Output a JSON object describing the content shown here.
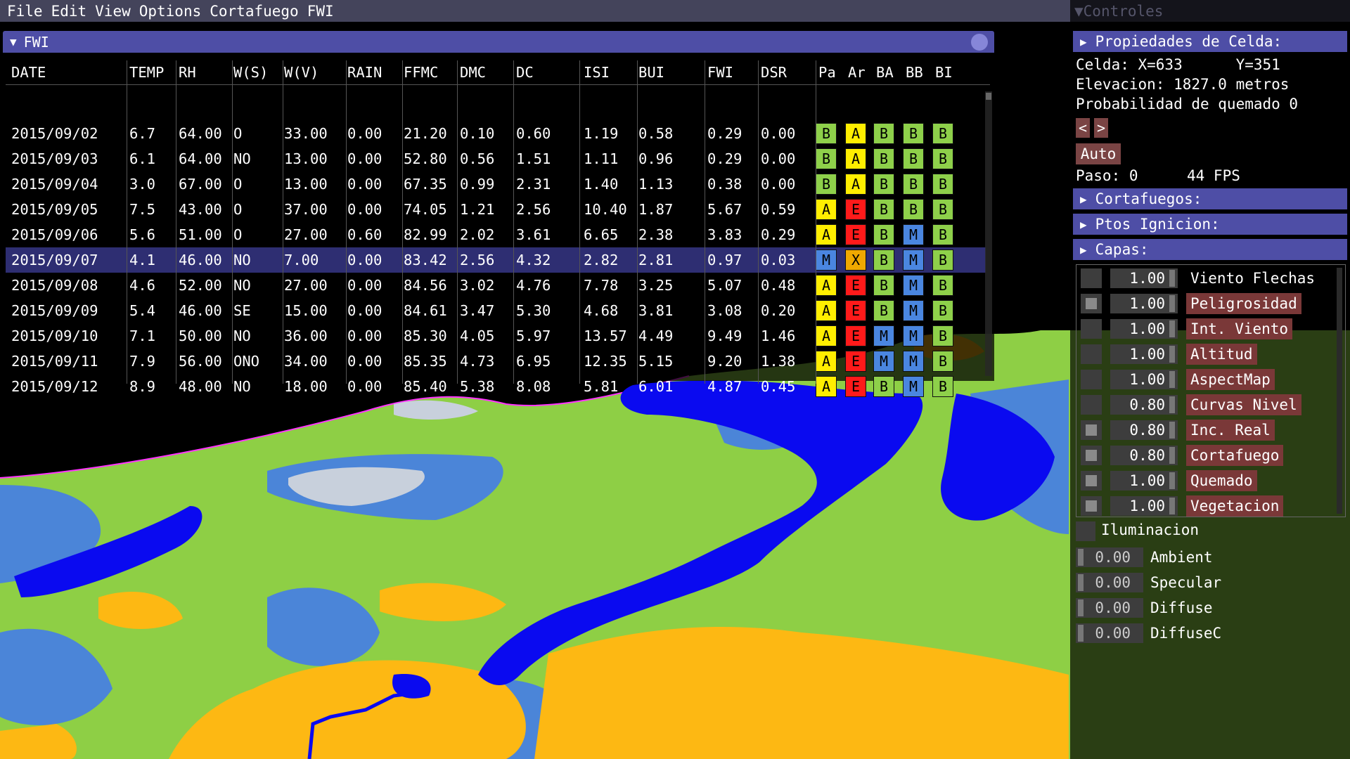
{
  "menu": [
    "File",
    "Edit",
    "View",
    "Options",
    "Cortafuego",
    "FWI"
  ],
  "fwi_window": {
    "title": "FWI",
    "columns": [
      "DATE",
      "TEMP",
      "RH",
      "W(S)",
      "W(V)",
      "RAIN",
      "FFMC",
      "DMC",
      "DC",
      "ISI",
      "BUI",
      "FWI",
      "DSR",
      "Pa",
      "Ar",
      "BA",
      "BB",
      "BI"
    ],
    "selected_row": 5,
    "rows": [
      {
        "date": "2015/09/02",
        "temp": "6.7",
        "rh": "64.00",
        "ws": "O",
        "wv": "33.00",
        "rain": "0.00",
        "ffmc": "21.20",
        "dmc": "0.10",
        "dc": "0.60",
        "isi": "1.19",
        "bui": "0.58",
        "fwi": "0.29",
        "dsr": "0.00",
        "pa": "B",
        "ar": "A",
        "ba": "B",
        "bb": "B",
        "bi": "B"
      },
      {
        "date": "2015/09/03",
        "temp": "6.1",
        "rh": "64.00",
        "ws": "NO",
        "wv": "13.00",
        "rain": "0.00",
        "ffmc": "52.80",
        "dmc": "0.56",
        "dc": "1.51",
        "isi": "1.11",
        "bui": "0.96",
        "fwi": "0.29",
        "dsr": "0.00",
        "pa": "B",
        "ar": "A",
        "ba": "B",
        "bb": "B",
        "bi": "B"
      },
      {
        "date": "2015/09/04",
        "temp": "3.0",
        "rh": "67.00",
        "ws": "O",
        "wv": "13.00",
        "rain": "0.00",
        "ffmc": "67.35",
        "dmc": "0.99",
        "dc": "2.31",
        "isi": "1.40",
        "bui": "1.13",
        "fwi": "0.38",
        "dsr": "0.00",
        "pa": "B",
        "ar": "A",
        "ba": "B",
        "bb": "B",
        "bi": "B"
      },
      {
        "date": "2015/09/05",
        "temp": "7.5",
        "rh": "43.00",
        "ws": "O",
        "wv": "37.00",
        "rain": "0.00",
        "ffmc": "74.05",
        "dmc": "1.21",
        "dc": "2.56",
        "isi": "10.40",
        "bui": "1.87",
        "fwi": "5.67",
        "dsr": "0.59",
        "pa": "A",
        "ar": "E",
        "ba": "B",
        "bb": "B",
        "bi": "B"
      },
      {
        "date": "2015/09/06",
        "temp": "5.6",
        "rh": "51.00",
        "ws": "O",
        "wv": "27.00",
        "rain": "0.60",
        "ffmc": "82.99",
        "dmc": "2.02",
        "dc": "3.61",
        "isi": "6.65",
        "bui": "2.38",
        "fwi": "3.83",
        "dsr": "0.29",
        "pa": "A",
        "ar": "E",
        "ba": "B",
        "bb": "M",
        "bi": "B"
      },
      {
        "date": "2015/09/07",
        "temp": "4.1",
        "rh": "46.00",
        "ws": "NO",
        "wv": "7.00",
        "rain": "0.00",
        "ffmc": "83.42",
        "dmc": "2.56",
        "dc": "4.32",
        "isi": "2.82",
        "bui": "2.81",
        "fwi": "0.97",
        "dsr": "0.03",
        "pa": "M",
        "ar": "X",
        "ba": "B",
        "bb": "M",
        "bi": "B"
      },
      {
        "date": "2015/09/08",
        "temp": "4.6",
        "rh": "52.00",
        "ws": "NO",
        "wv": "27.00",
        "rain": "0.00",
        "ffmc": "84.56",
        "dmc": "3.02",
        "dc": "4.76",
        "isi": "7.78",
        "bui": "3.25",
        "fwi": "5.07",
        "dsr": "0.48",
        "pa": "A",
        "ar": "E",
        "ba": "B",
        "bb": "M",
        "bi": "B"
      },
      {
        "date": "2015/09/09",
        "temp": "5.4",
        "rh": "46.00",
        "ws": "SE",
        "wv": "15.00",
        "rain": "0.00",
        "ffmc": "84.61",
        "dmc": "3.47",
        "dc": "5.30",
        "isi": "4.68",
        "bui": "3.81",
        "fwi": "3.08",
        "dsr": "0.20",
        "pa": "A",
        "ar": "E",
        "ba": "B",
        "bb": "M",
        "bi": "B"
      },
      {
        "date": "2015/09/10",
        "temp": "7.1",
        "rh": "50.00",
        "ws": "NO",
        "wv": "36.00",
        "rain": "0.00",
        "ffmc": "85.30",
        "dmc": "4.05",
        "dc": "5.97",
        "isi": "13.57",
        "bui": "4.49",
        "fwi": "9.49",
        "dsr": "1.46",
        "pa": "A",
        "ar": "E",
        "ba": "M",
        "bb": "M",
        "bi": "B"
      },
      {
        "date": "2015/09/11",
        "temp": "7.9",
        "rh": "56.00",
        "ws": "ONO",
        "wv": "34.00",
        "rain": "0.00",
        "ffmc": "85.35",
        "dmc": "4.73",
        "dc": "6.95",
        "isi": "12.35",
        "bui": "5.15",
        "fwi": "9.20",
        "dsr": "1.38",
        "pa": "A",
        "ar": "E",
        "ba": "M",
        "bb": "M",
        "bi": "B"
      },
      {
        "date": "2015/09/12",
        "temp": "8.9",
        "rh": "48.00",
        "ws": "NO",
        "wv": "18.00",
        "rain": "0.00",
        "ffmc": "85.40",
        "dmc": "5.38",
        "dc": "8.08",
        "isi": "5.81",
        "bui": "6.01",
        "fwi": "4.87",
        "dsr": "0.45",
        "pa": "A",
        "ar": "E",
        "ba": "B",
        "bb": "M",
        "bi": "B"
      }
    ],
    "badge_colors": {
      "B": "#8ed04a",
      "A": "#ffee00",
      "E": "#ff1a1a",
      "M": "#4a86e0",
      "X": "#f0a800"
    }
  },
  "controls": {
    "title": "Controles",
    "cell_props": {
      "header": "Propiedades de Celda:",
      "celda": "Celda: X=633      Y=351",
      "elevacion": "Elevacion: 1827.0 metros",
      "probabilidad": "Probabilidad de quemado 0",
      "prev": "<",
      "next": ">",
      "auto": "Auto",
      "paso": "Paso: 0",
      "fps": "44 FPS"
    },
    "sections": [
      "Cortafuegos:",
      "Ptos Ignicion:",
      "Capas:"
    ],
    "layers": [
      {
        "value": "1.00",
        "label": "Viento Flechas",
        "highlight": false,
        "checked": false
      },
      {
        "value": "1.00",
        "label": "Peligrosidad",
        "highlight": true,
        "checked": true
      },
      {
        "value": "1.00",
        "label": "Int. Viento",
        "highlight": true,
        "checked": false
      },
      {
        "value": "1.00",
        "label": "Altitud",
        "highlight": true,
        "checked": false
      },
      {
        "value": "1.00",
        "label": "AspectMap",
        "highlight": true,
        "checked": false
      },
      {
        "value": "0.80",
        "label": "Curvas Nivel",
        "highlight": true,
        "checked": false
      },
      {
        "value": "0.80",
        "label": "Inc. Real",
        "highlight": true,
        "checked": true
      },
      {
        "value": "0.80",
        "label": "Cortafuego",
        "highlight": true,
        "checked": true
      },
      {
        "value": "1.00",
        "label": "Quemado",
        "highlight": true,
        "checked": true
      },
      {
        "value": "1.00",
        "label": "Vegetacion",
        "highlight": true,
        "checked": true
      }
    ],
    "illumination": {
      "label": "Iluminacion",
      "sliders": [
        {
          "value": "0.00",
          "label": "Ambient"
        },
        {
          "value": "0.00",
          "label": "Specular"
        },
        {
          "value": "0.00",
          "label": "Diffuse"
        },
        {
          "value": "0.00",
          "label": "DiffuseC"
        }
      ]
    }
  },
  "terrain_colors": {
    "water": "#0a0af0",
    "grass": "#8ecf45",
    "shrub": "#4b85d8",
    "fuel": "#fdb813",
    "rock": "#c8d0dc",
    "border": "#ff33ff"
  }
}
